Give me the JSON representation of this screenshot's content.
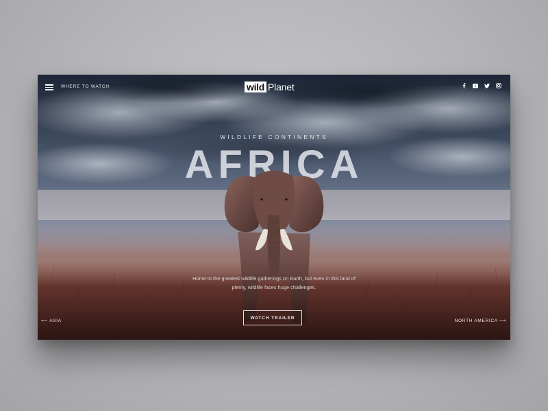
{
  "header": {
    "nav_label": "WHERE TO WATCH",
    "logo": {
      "boxed": "wild",
      "rest": "Planet"
    },
    "social_icons": [
      "facebook-icon",
      "youtube-icon",
      "twitter-icon",
      "instagram-icon"
    ]
  },
  "hero": {
    "eyebrow": "WILDLIFE CONTINENTS",
    "title": "AFRICA",
    "description": "Home to the greatest wildlife gatherings on Earth, but even in this land of plenty, wildlife faces huge challenges.",
    "cta_label": "WATCH TRAILER"
  },
  "pager": {
    "prev_label": "ASIA",
    "next_label": "NORTH AMERICA",
    "prev_arrow": "⟵",
    "next_arrow": "⟶"
  },
  "colors": {
    "sky_top": "#1f2a3a",
    "sky_mid": "#5b6a82",
    "horizon": "#d9c9c0",
    "grass": "#5a2f28",
    "elephant": "#6b4a44",
    "text": "#ffffff"
  }
}
